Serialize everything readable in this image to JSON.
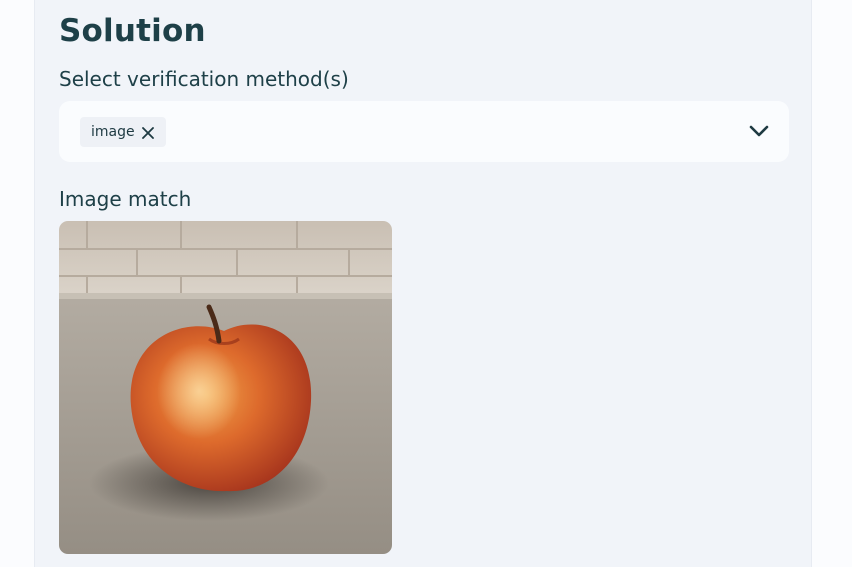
{
  "solution": {
    "title": "Solution",
    "select_label": "Select verification method(s)",
    "selected_methods": [
      "image"
    ],
    "chevron_icon": "chevron-down-icon",
    "remove_icon": "close-icon",
    "image_match_label": "Image match",
    "image_subject": "photo of a red apple on a countertop"
  },
  "colors": {
    "panel_bg": "#f1f4f9",
    "text": "#1e4048",
    "select_bg": "#fafcfe",
    "chip_bg": "#eef1f6"
  }
}
